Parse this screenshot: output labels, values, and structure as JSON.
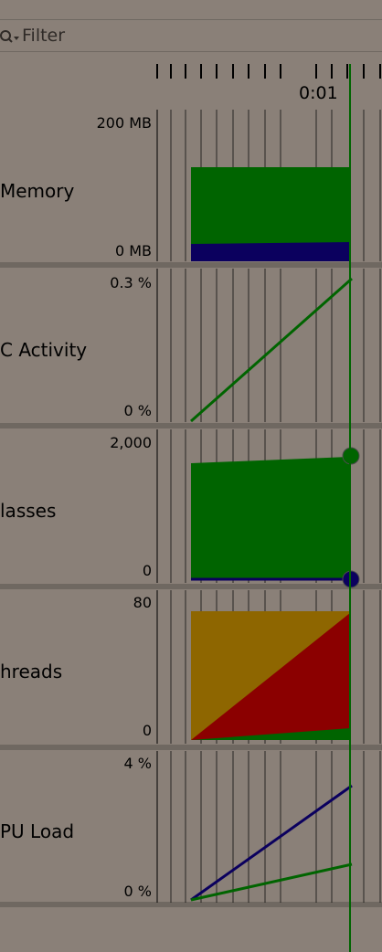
{
  "filter": {
    "label": "Filter",
    "icon": "search-icon"
  },
  "timeline": {
    "tick_label": "0:01"
  },
  "panels": [
    {
      "title": "Memory",
      "scale_top": "200 MB",
      "scale_bottom": "0 MB"
    },
    {
      "title": "C Activity",
      "scale_top": "0.3 %",
      "scale_bottom": "0 %"
    },
    {
      "title": "lasses",
      "scale_top": "2,000",
      "scale_bottom": "0"
    },
    {
      "title": "hreads",
      "scale_top": "80",
      "scale_bottom": "0"
    },
    {
      "title": "PU Load",
      "scale_top": "4 %",
      "scale_bottom": "0 %"
    }
  ],
  "colors": {
    "green": "#006400",
    "navy": "#0b005e",
    "olive": "#8e6600",
    "red": "#8b0000",
    "background": "#8a8078",
    "divider": "#6f6861"
  }
}
